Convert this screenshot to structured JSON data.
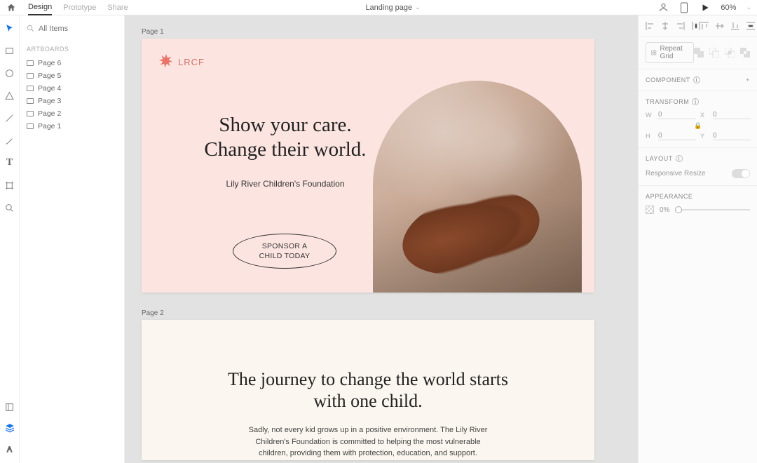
{
  "header": {
    "tabs": [
      "Design",
      "Prototype",
      "Share"
    ],
    "active_tab": 0,
    "document_title": "Landing page",
    "zoom": "60%"
  },
  "left_panel": {
    "search_placeholder": "All Items",
    "artboards_label": "ARTBOARDS",
    "artboards": [
      "Page 6",
      "Page 5",
      "Page 4",
      "Page 3",
      "Page 2",
      "Page 1"
    ]
  },
  "canvas": {
    "page1_label": "Page 1",
    "page2_label": "Page 2",
    "logo_text": "LRCF",
    "headline_line1": "Show your care.",
    "headline_line2": "Change their world.",
    "subheadline": "Lily River Children's Foundation",
    "cta_line1": "SPONSOR A",
    "cta_line2": "CHILD TODAY",
    "page2_headline": "The journey to change the world starts with one child.",
    "page2_body": "Sadly, not every kid grows up in a positive environment. The Lily River Children's Foundation is committed to helping the most vulnerable children, providing them with protection, education, and support."
  },
  "right_panel": {
    "repeat_grid": "Repeat Grid",
    "component_label": "COMPONENT",
    "transform_label": "TRANSFORM",
    "w_label": "W",
    "w_value": "0",
    "x_label": "X",
    "x_value": "0",
    "h_label": "H",
    "h_value": "0",
    "y_label": "Y",
    "y_value": "0",
    "layout_label": "LAYOUT",
    "responsive_resize": "Responsive Resize",
    "appearance_label": "APPEARANCE",
    "opacity": "0%"
  }
}
